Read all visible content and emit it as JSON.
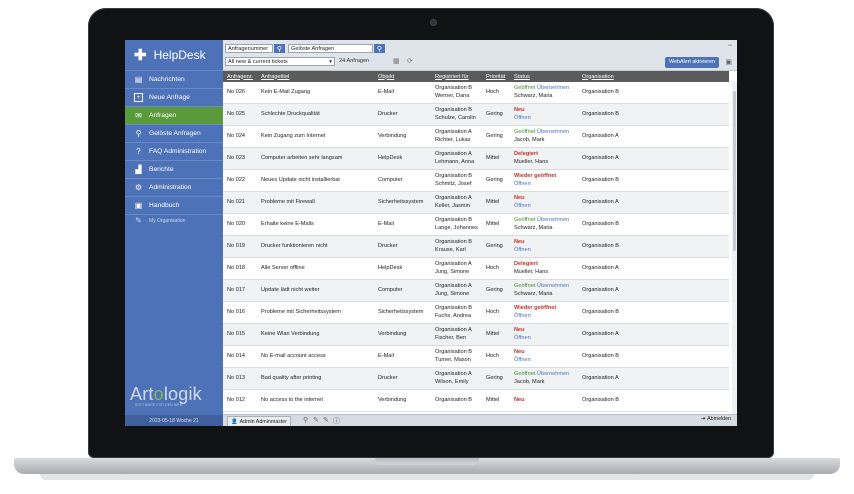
{
  "sidebar": {
    "brand": "HelpDesk",
    "items": [
      {
        "label": "Nachrichten",
        "icon": "messages-icon",
        "glyph": "▤"
      },
      {
        "label": "Neue Anfrage",
        "icon": "plus-square-icon",
        "glyph": "+"
      },
      {
        "label": "Anfragen",
        "icon": "inbox-icon",
        "glyph": "✉"
      },
      {
        "label": "Gelöste Anfragen",
        "icon": "search-icon",
        "glyph": "⚲"
      },
      {
        "label": "FAQ Administration",
        "icon": "question-icon",
        "glyph": "?"
      },
      {
        "label": "Berichte",
        "icon": "bar-chart-icon",
        "glyph": "▟"
      },
      {
        "label": "Administration",
        "icon": "gears-icon",
        "glyph": "⚙"
      },
      {
        "label": "Handbuch",
        "icon": "book-icon",
        "glyph": "▣"
      },
      {
        "label": "My Organisation",
        "icon": "pencil-icon",
        "glyph": "✎"
      }
    ],
    "logo_text_a": "Art",
    "logo_text_o": "o",
    "logo_text_b": "logik",
    "tagline": "SOFTWARE FÜR DEN WEB",
    "date_week": "2023-05-18  Woche 21"
  },
  "toolbar": {
    "search_type": "Anfragenummer",
    "search_value": "Gelöste Anfragen",
    "filter_value": "All new & current tickets",
    "count_text": "24 Anfragen",
    "webalert_label": "WebAlert aktivieren"
  },
  "table": {
    "columns": [
      "Anfragenr.",
      "Anfragetitel",
      "Objekt",
      "Registriert für",
      "Priorität",
      "Status",
      "Organisation"
    ],
    "rows": [
      {
        "nr": "No 026",
        "title": "Kein E-Mail Zugang",
        "obj": "E-Mail",
        "reg1": "Organisation B",
        "reg2": "Werner, Dana",
        "prio": "Hoch",
        "status": "Geöffnet",
        "action": "Übernehmen",
        "sub": "Schwarz, Maria",
        "org": "Organisation B",
        "kind": "green"
      },
      {
        "nr": "No 025",
        "title": "Schlechte Druckqualität",
        "obj": "Drucker",
        "reg1": "Organisation B",
        "reg2": "Schulze, Carolin",
        "prio": "Gering",
        "status": "Neu",
        "action": "",
        "sub": "Öffnen",
        "org": "Organisation B",
        "kind": "red"
      },
      {
        "nr": "No 024",
        "title": "Kein Zugang zum Internet",
        "obj": "Verbindung",
        "reg1": "Organisation A",
        "reg2": "Richter, Lukas",
        "prio": "Gering",
        "status": "Geöffnet",
        "action": "Übernehmen",
        "sub": "Jacob, Mark",
        "org": "Organisation A",
        "kind": "green"
      },
      {
        "nr": "No 023",
        "title": "Computer arbeiten sehr langsam",
        "obj": "HelpDesk",
        "reg1": "Organisation A",
        "reg2": "Lehmann, Anna",
        "prio": "Mittel",
        "status": "Delegiert",
        "action": "",
        "sub": "Mueller, Hans",
        "org": "Organisation A",
        "kind": "red"
      },
      {
        "nr": "No 022",
        "title": "Neues Update nicht installierbar",
        "obj": "Computer",
        "reg1": "Organisation B",
        "reg2": "Schmitz, Josef",
        "prio": "Gering",
        "status": "Wieder geöffnet",
        "action": "",
        "sub": "Öffnen",
        "org": "Organisation B",
        "kind": "red"
      },
      {
        "nr": "No 021",
        "title": "Probleme mit Firewall",
        "obj": "Sicherheitssystem",
        "reg1": "Organisation A",
        "reg2": "Keller, Jasmin",
        "prio": "Mittel",
        "status": "Neu",
        "action": "",
        "sub": "Öffnen",
        "org": "Organisation A",
        "kind": "red"
      },
      {
        "nr": "No 020",
        "title": "Erhalte keine E-Mails",
        "obj": "E-Mail",
        "reg1": "Organisation B",
        "reg2": "Lange, Johannes",
        "prio": "Mittel",
        "status": "Geöffnet",
        "action": "Übernehmen",
        "sub": "Schwarz, Maria",
        "org": "Organisation B",
        "kind": "green"
      },
      {
        "nr": "No 019",
        "title": "Drucker funktionieren nicht",
        "obj": "Drucker",
        "reg1": "Organisation B",
        "reg2": "Krause, Karl",
        "prio": "Gering",
        "status": "Neu",
        "action": "",
        "sub": "Öffnen",
        "org": "Organisation B",
        "kind": "red"
      },
      {
        "nr": "No 018",
        "title": "Alle Server offline",
        "obj": "HelpDesk",
        "reg1": "Organisation A",
        "reg2": "Jung, Simone",
        "prio": "Hoch",
        "status": "Delegiert",
        "action": "",
        "sub": "Mueller, Hans",
        "org": "Organisation A",
        "kind": "red"
      },
      {
        "nr": "No 017",
        "title": "Update lädt nicht weiter",
        "obj": "Computer",
        "reg1": "Organisation A",
        "reg2": "Jung, Simone",
        "prio": "Gering",
        "status": "Geöffnet",
        "action": "Übernehmen",
        "sub": "Schwarz, Maria",
        "org": "Organisation A",
        "kind": "green"
      },
      {
        "nr": "No 016",
        "title": "Probleme mit Sicherheitssystem",
        "obj": "Sicherheitssystem",
        "reg1": "Organisation B",
        "reg2": "Fuchs, Andrea",
        "prio": "Hoch",
        "status": "Wieder geöffnet",
        "action": "",
        "sub": "Öffnen",
        "org": "Organisation B",
        "kind": "red"
      },
      {
        "nr": "No 015",
        "title": "Keine Wlan Verbindung",
        "obj": "Verbindung",
        "reg1": "Organisation A",
        "reg2": "Fischer, Ben",
        "prio": "Mittel",
        "status": "Neu",
        "action": "",
        "sub": "Öffnen",
        "org": "Organisation A",
        "kind": "red"
      },
      {
        "nr": "No 014",
        "title": "No E-mail account access",
        "obj": "E-Mail",
        "reg1": "Organisation B",
        "reg2": "Turner, Mason",
        "prio": "Hoch",
        "status": "Neu",
        "action": "",
        "sub": "Öffnen",
        "org": "Organisation B",
        "kind": "red"
      },
      {
        "nr": "No 013",
        "title": "Bad quality after printing",
        "obj": "Drucker",
        "reg1": "Organisation A",
        "reg2": "Wilson, Emily",
        "prio": "Gering",
        "status": "Geöffnet",
        "action": "Übernehmen",
        "sub": "Jacob, Mark",
        "org": "Organisation A",
        "kind": "green"
      },
      {
        "nr": "No 012",
        "title": "No access to the internet",
        "obj": "Verbindung",
        "reg1": "Organisation B",
        "reg2": "",
        "prio": "Mittel",
        "status": "Neu",
        "action": "",
        "sub": "",
        "org": "Organisation B",
        "kind": "red"
      }
    ]
  },
  "statusbar": {
    "user": "Admin Adminmaster",
    "logout": "Abmelden"
  },
  "colors": {
    "sidebar": "#4e72b7",
    "active": "#5a9a3b",
    "header": "#5b5b5b",
    "status_green": "#3f8f2f",
    "status_red": "#c0302b",
    "link_blue": "#4a72c0"
  }
}
